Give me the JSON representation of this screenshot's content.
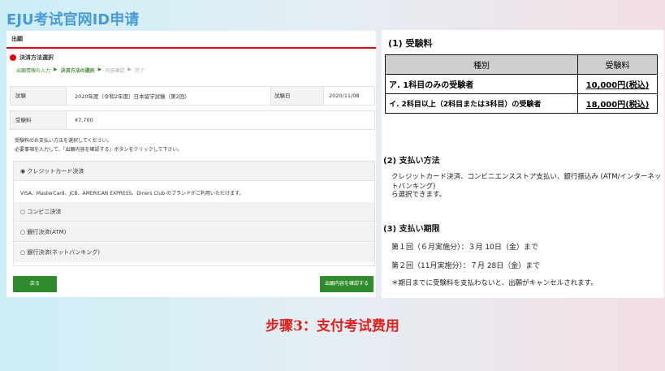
{
  "slide": {
    "title": "EJU考试官网ID申请",
    "caption": "步骤3：支付考试费用"
  },
  "screenshot": {
    "header": "出願",
    "step_title": "決済方法選択",
    "steps": [
      "出願情報の入力",
      "決済方法の選択",
      "内容確認",
      "完了"
    ],
    "step_sep": "▶",
    "exam_label": "試験",
    "exam_value": "2020年度（令和2年度）日本留学試験（第2回）",
    "date_label": "試験日",
    "date_value": "2020/11/08",
    "fee_label": "受験料",
    "fee_value": "¥7,700",
    "note1": "受験料のお支払い方法を選択してください。",
    "note2": "必要事項を入力して、「出願内容を確認する」ボタンをクリックして下さい。",
    "payment_options": [
      "クレジットカード決済",
      "コンビニ決済",
      "銀行決済(ATM)",
      "銀行決済(ネットバンキング)"
    ],
    "card_desc": "VISA、MasterCard、JCB、AMERICAN EXPRESS、Diners Club のブランドがご利用いただけます。",
    "back_button": "戻る",
    "confirm_button": "出願内容を確認する"
  },
  "document": {
    "fee_heading": "(1) 受験料",
    "table_headers": [
      "種別",
      "受験料"
    ],
    "rows": [
      {
        "label": "ア. 1科目のみの受験者",
        "fee": "10,000円(税込)"
      },
      {
        "label": "イ. 2科目以上（2科目または3科目）の受験者",
        "fee": "18,000円(税込)"
      }
    ],
    "method_heading": "(2) 支払い方法",
    "method_text1": "クレジットカード決済、コンビニエンスストア支払い、銀行振込み (ATM/インターネットバンキング)",
    "method_text2": "ら選択できます。",
    "deadline_heading": "(3) 支払い期限",
    "deadline1": "第１回（６月実施分）：３月 10日（金）まで",
    "deadline2": "第２回（11月実施分）：７月 28日（金）まで",
    "deadline_note": "＊期日までに受験料を支払わないと、出願がキャンセルされます。"
  }
}
